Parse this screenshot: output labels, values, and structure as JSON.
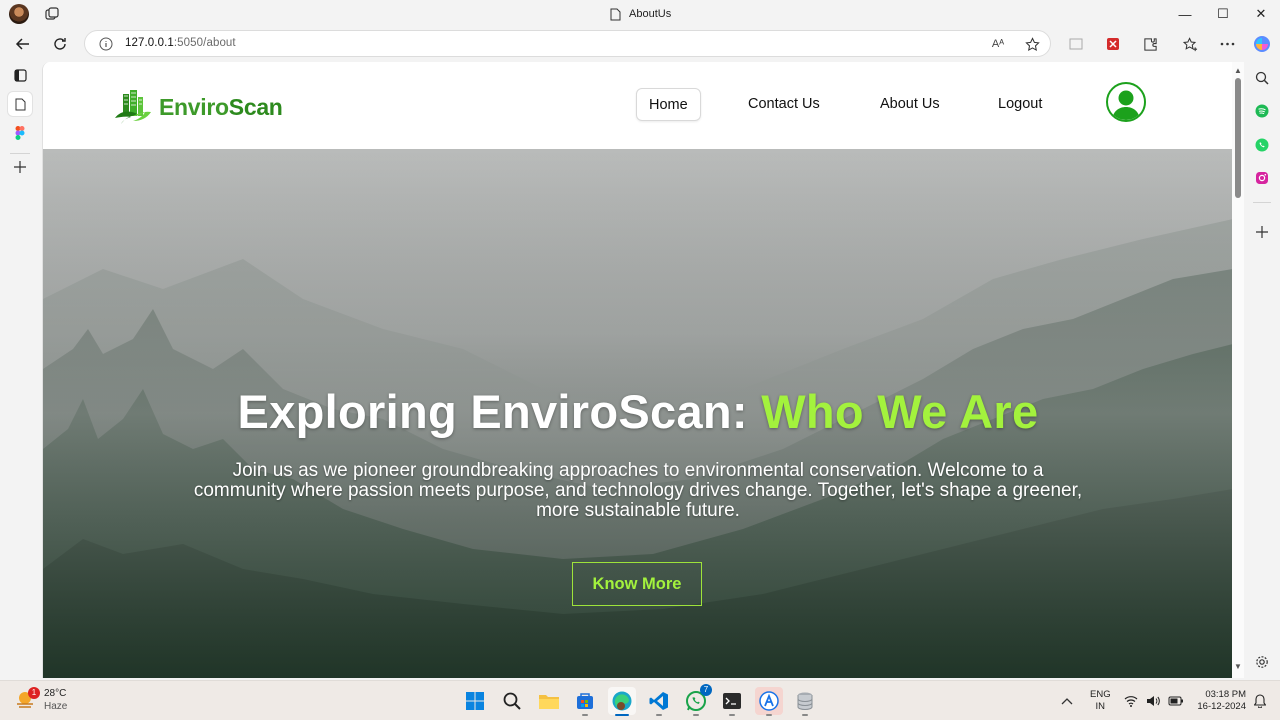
{
  "window": {
    "tab_title": "AboutUs",
    "controls": {
      "minimize": "—",
      "maximize": "☐",
      "close": "✕"
    }
  },
  "addressbar": {
    "url_host": "127.0.0.1",
    "url_rest": ":5050/about",
    "read_aloud_label": "Aᴬ"
  },
  "site": {
    "logo_part1": "Enviro",
    "logo_part2": "Scan",
    "nav": [
      {
        "label": "Home",
        "active": true
      },
      {
        "label": "Contact Us"
      },
      {
        "label": "About Us"
      },
      {
        "label": "Logout"
      }
    ],
    "hero": {
      "title_main": "Exploring EnviroScan: ",
      "title_accent": "Who We Are",
      "text": "Join us as we pioneer groundbreaking approaches to environmental conservation. Welcome to a community where passion meets purpose, and technology drives change. Together, let's shape a greener, more sustainable future.",
      "button": "Know More"
    },
    "colors": {
      "accent": "#a3f23d",
      "brand": "#3d9a2a",
      "profile_ring": "#1ca11c"
    }
  },
  "taskbar": {
    "weather": {
      "temp": "28°C",
      "condition": "Haze",
      "badge": "1"
    },
    "whatsapp_badge": "7",
    "lang_line1": "ENG",
    "lang_line2": "IN",
    "time": "03:18 PM",
    "date": "16-12-2024"
  }
}
